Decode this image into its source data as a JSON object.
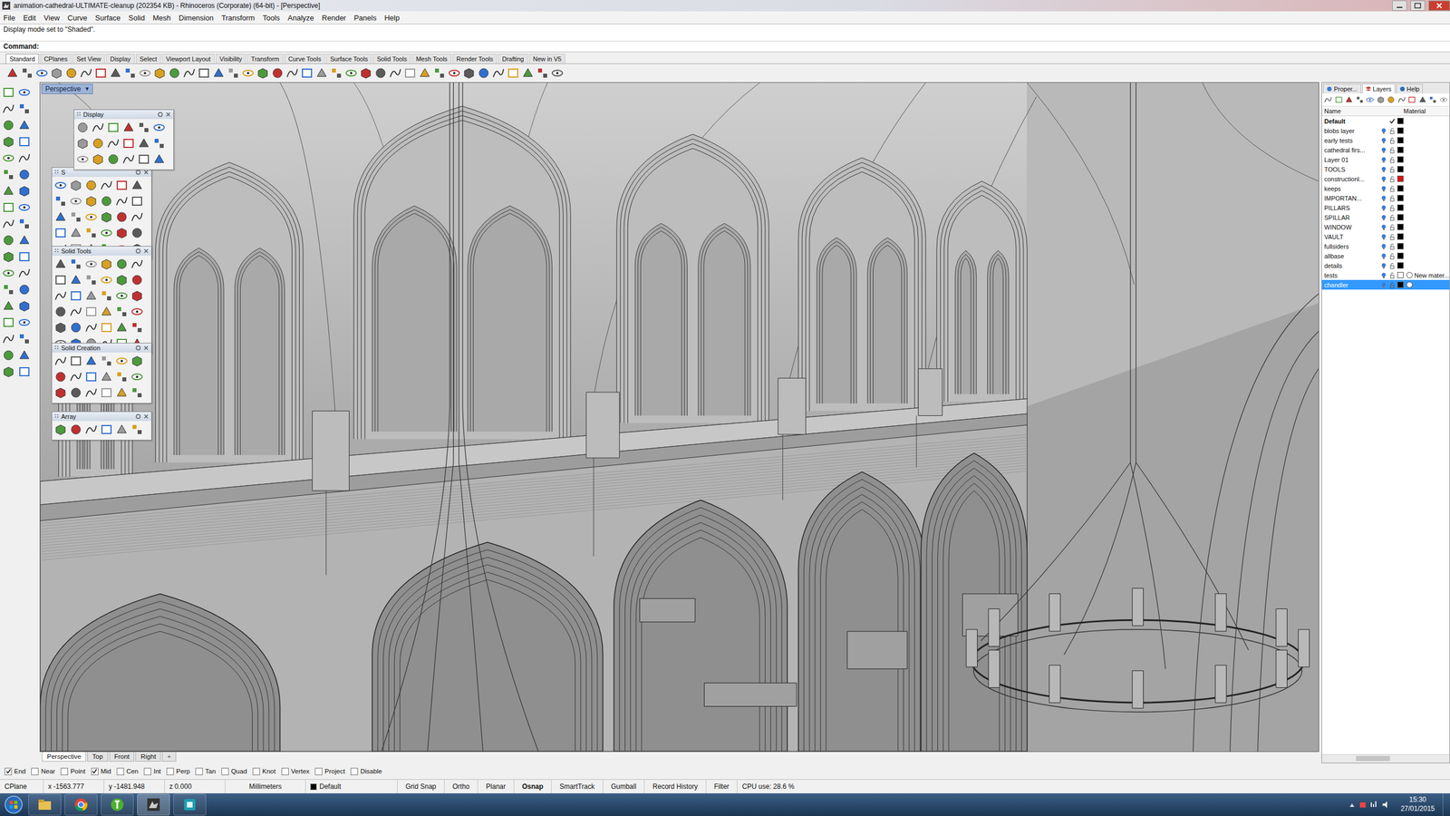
{
  "window": {
    "title": "animation-cathedral-ULTIMATE-cleanup (202354 KB) - Rhinoceros (Corporate) (64-bit) - [Perspective]"
  },
  "menu": [
    "File",
    "Edit",
    "View",
    "Curve",
    "Surface",
    "Solid",
    "Mesh",
    "Dimension",
    "Transform",
    "Tools",
    "Analyze",
    "Render",
    "Panels",
    "Help"
  ],
  "command": {
    "history": "Display mode set to \"Shaded\".",
    "prompt": "Command:"
  },
  "toolbar_tabs": [
    {
      "label": "Standard",
      "selected": true
    },
    {
      "label": "CPlanes",
      "selected": false
    },
    {
      "label": "Set View",
      "selected": false
    },
    {
      "label": "Display",
      "selected": false
    },
    {
      "label": "Select",
      "selected": false
    },
    {
      "label": "Viewport Layout",
      "selected": false
    },
    {
      "label": "Visibility",
      "selected": false
    },
    {
      "label": "Transform",
      "selected": false
    },
    {
      "label": "Curve Tools",
      "selected": false
    },
    {
      "label": "Surface Tools",
      "selected": false
    },
    {
      "label": "Solid Tools",
      "selected": false
    },
    {
      "label": "Mesh Tools",
      "selected": false
    },
    {
      "label": "Render Tools",
      "selected": false
    },
    {
      "label": "Drafting",
      "selected": false
    },
    {
      "label": "New in V5",
      "selected": false
    }
  ],
  "viewport": {
    "label": "Perspective",
    "arrow": "▾"
  },
  "floating_panels": [
    {
      "title": "Display"
    },
    {
      "title": "S"
    },
    {
      "title": "Solid Tools"
    },
    {
      "title": "Solid Creation"
    },
    {
      "title": "Array"
    }
  ],
  "panel_tabs": [
    {
      "label": "Proper...",
      "selected": false
    },
    {
      "label": "Layers",
      "selected": true
    },
    {
      "label": "Help",
      "selected": false
    }
  ],
  "layers": {
    "columns": [
      "Name",
      "Material"
    ],
    "rows": [
      {
        "name": "Default",
        "current": true,
        "selected": false,
        "color": "#000000",
        "material": "",
        "material_set": false
      },
      {
        "name": "blobs layer",
        "current": false,
        "selected": false,
        "color": "#000000",
        "material": "",
        "material_set": false
      },
      {
        "name": "early tests",
        "current": false,
        "selected": false,
        "color": "#000000",
        "material": "",
        "material_set": false
      },
      {
        "name": "cathedral firs...",
        "current": false,
        "selected": false,
        "color": "#000000",
        "material": "",
        "material_set": false
      },
      {
        "name": "Layer 01",
        "current": false,
        "selected": false,
        "color": "#000000",
        "material": "",
        "material_set": false
      },
      {
        "name": "TOOLS",
        "current": false,
        "selected": false,
        "color": "#000000",
        "material": "",
        "material_set": false
      },
      {
        "name": "constructionl...",
        "current": false,
        "selected": false,
        "color": "#e01010",
        "material": "",
        "material_set": false
      },
      {
        "name": "keeps",
        "current": false,
        "selected": false,
        "color": "#000000",
        "material": "",
        "material_set": false
      },
      {
        "name": "IMPORTAN...",
        "current": false,
        "selected": false,
        "color": "#000000",
        "material": "",
        "material_set": false
      },
      {
        "name": "PILLARS",
        "current": false,
        "selected": false,
        "color": "#000000",
        "material": "",
        "material_set": false
      },
      {
        "name": "SPILLAR",
        "current": false,
        "selected": false,
        "color": "#000000",
        "material": "",
        "material_set": false
      },
      {
        "name": "WINDOW",
        "current": false,
        "selected": false,
        "color": "#000000",
        "material": "",
        "material_set": false
      },
      {
        "name": "VAULT",
        "current": false,
        "selected": false,
        "color": "#000000",
        "material": "",
        "material_set": false
      },
      {
        "name": "fullsiders",
        "current": false,
        "selected": false,
        "color": "#000000",
        "material": "",
        "material_set": false
      },
      {
        "name": "allbase",
        "current": false,
        "selected": false,
        "color": "#000000",
        "material": "",
        "material_set": false
      },
      {
        "name": "details",
        "current": false,
        "selected": false,
        "color": "#000000",
        "material": "",
        "material_set": false
      },
      {
        "name": "tests",
        "current": false,
        "selected": false,
        "color": "#ffffff",
        "material": "New mater...",
        "material_set": true
      },
      {
        "name": "chandler",
        "current": false,
        "selected": true,
        "color": "#000000",
        "material": "",
        "material_set": true
      }
    ]
  },
  "viewport_tabs": {
    "tabs": [
      {
        "label": "Perspective",
        "selected": true
      },
      {
        "label": "Top",
        "selected": false
      },
      {
        "label": "Front",
        "selected": false
      },
      {
        "label": "Right",
        "selected": false
      }
    ],
    "add": "+"
  },
  "osnaps": [
    {
      "label": "End",
      "checked": true
    },
    {
      "label": "Near",
      "checked": false
    },
    {
      "label": "Point",
      "checked": false
    },
    {
      "label": "Mid",
      "checked": true
    },
    {
      "label": "Cen",
      "checked": false
    },
    {
      "label": "Int",
      "checked": false
    },
    {
      "label": "Perp",
      "checked": false
    },
    {
      "label": "Tan",
      "checked": false
    },
    {
      "label": "Quad",
      "checked": false
    },
    {
      "label": "Knot",
      "checked": false
    },
    {
      "label": "Vertex",
      "checked": false
    },
    {
      "label": "Project",
      "checked": false
    },
    {
      "label": "Disable",
      "checked": false
    }
  ],
  "status_bar": {
    "cplane": "CPlane",
    "x": "x -1563.777",
    "y": "y -1481.948",
    "z": "z 0.000",
    "units": "Millimeters",
    "layer": "Default",
    "layer_color": "#000000",
    "toggles": [
      {
        "label": "Grid Snap",
        "on": false
      },
      {
        "label": "Ortho",
        "on": false
      },
      {
        "label": "Planar",
        "on": false
      },
      {
        "label": "Osnap",
        "on": true
      },
      {
        "label": "SmartTrack",
        "on": false
      },
      {
        "label": "Gumball",
        "on": false
      },
      {
        "label": "Record History",
        "on": false
      },
      {
        "label": "Filter",
        "on": false
      }
    ],
    "cpu": "CPU use: 28.6 %"
  },
  "taskbar": {
    "time": "15:30",
    "date": "27/01/2015"
  }
}
